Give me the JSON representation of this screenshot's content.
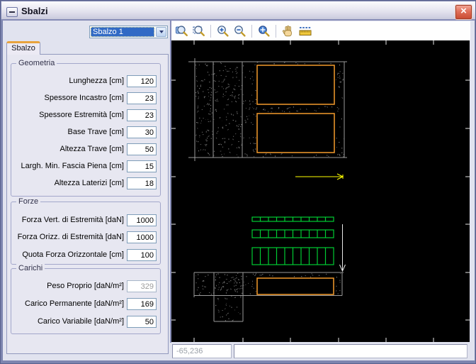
{
  "window": {
    "title": "Sbalzi",
    "sysmenu_symbol": "",
    "close_symbol": "×"
  },
  "selector": {
    "value": "Sbalzo 1"
  },
  "tab": {
    "label": "Sbalzo"
  },
  "groups": [
    {
      "title": "Geometria",
      "fields": [
        {
          "label": "Lunghezza [cm]",
          "value": "120"
        },
        {
          "label": "Spessore Incastro [cm]",
          "value": "23"
        },
        {
          "label": "Spessore Estremità [cm]",
          "value": "23"
        },
        {
          "label": "Base Trave [cm]",
          "value": "30"
        },
        {
          "label": "Altezza Trave [cm]",
          "value": "50"
        },
        {
          "label": "Largh. Min. Fascia Piena [cm]",
          "value": "15"
        },
        {
          "label": "Altezza Laterizi [cm]",
          "value": "18"
        }
      ]
    },
    {
      "title": "Forze",
      "fields": [
        {
          "label": "Forza Vert. di Estremità [daN]",
          "value": "1000"
        },
        {
          "label": "Forza Orizz. di Estremità [daN]",
          "value": "1000"
        },
        {
          "label": "Quota Forza Orizzontale [cm]",
          "value": "100"
        }
      ]
    },
    {
      "title": "Carichi",
      "fields": [
        {
          "label": "Peso Proprio [daN/m²]",
          "value": "329",
          "disabled": true
        },
        {
          "label": "Carico Permanente [daN/m²]",
          "value": "169"
        },
        {
          "label": "Carico Variabile [daN/m²]",
          "value": "50"
        }
      ]
    }
  ],
  "toolbar": {
    "icons": [
      "zoom-all",
      "zoom-window",
      "zoom-in",
      "zoom-out",
      "zoom-dynamic",
      "pan-hand",
      "measure-ruler"
    ]
  },
  "statusbar": {
    "coordinates": "-65,236",
    "message": ""
  },
  "drawing": {
    "colors": {
      "background": "#000000",
      "outline_gray": "#9a9a9a",
      "speckle_gray": "#7d7d7d",
      "block_orange": "#f49a2c",
      "load_green": "#00cc33",
      "force_yellow": "#ffff00",
      "force_white": "#e8e8e8",
      "tick_white": "#e6e6e6"
    }
  }
}
